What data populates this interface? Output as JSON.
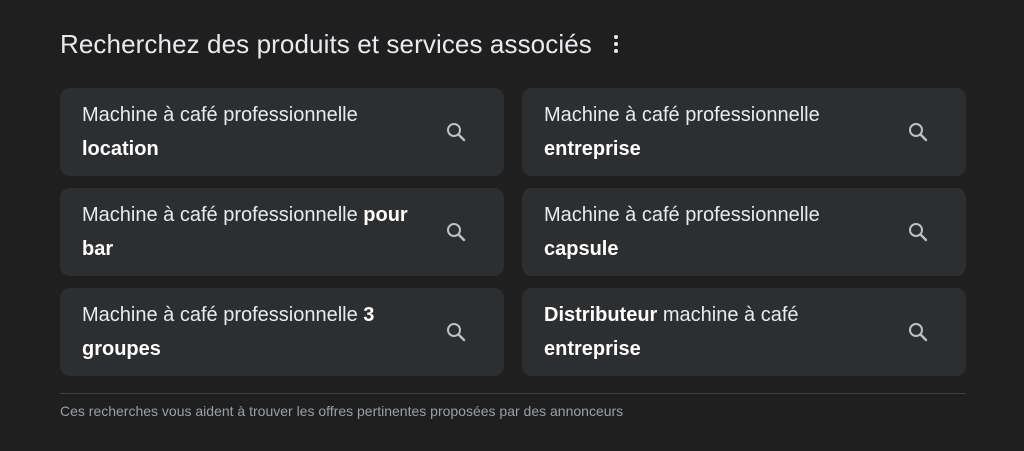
{
  "header": {
    "title": "Recherchez des produits et services associés",
    "more_icon": "more-vert-icon"
  },
  "suggestions": [
    {
      "prefix": "Machine à café professionnelle ",
      "bold": "location",
      "suffix": ""
    },
    {
      "prefix": "Machine à café professionnelle ",
      "bold": "entreprise",
      "suffix": ""
    },
    {
      "prefix": "Machine à café professionnelle ",
      "bold": "pour bar",
      "suffix": ""
    },
    {
      "prefix": "Machine à café professionnelle ",
      "bold": "capsule",
      "suffix": ""
    },
    {
      "prefix": "Machine à café professionnelle ",
      "bold": "3 groupes",
      "suffix": ""
    },
    {
      "prefix": "",
      "bold": "Distributeur",
      "suffix": " machine à café ",
      "bold2": "entreprise"
    }
  ],
  "search_icon": "search-icon",
  "footer": {
    "text": "Ces recherches vous aident à trouver les offres pertinentes proposées par des annonceurs"
  },
  "colors": {
    "background": "#1f1f1f",
    "card": "#2d2e30",
    "text": "#e8eaed",
    "muted": "#9aa0a6"
  }
}
